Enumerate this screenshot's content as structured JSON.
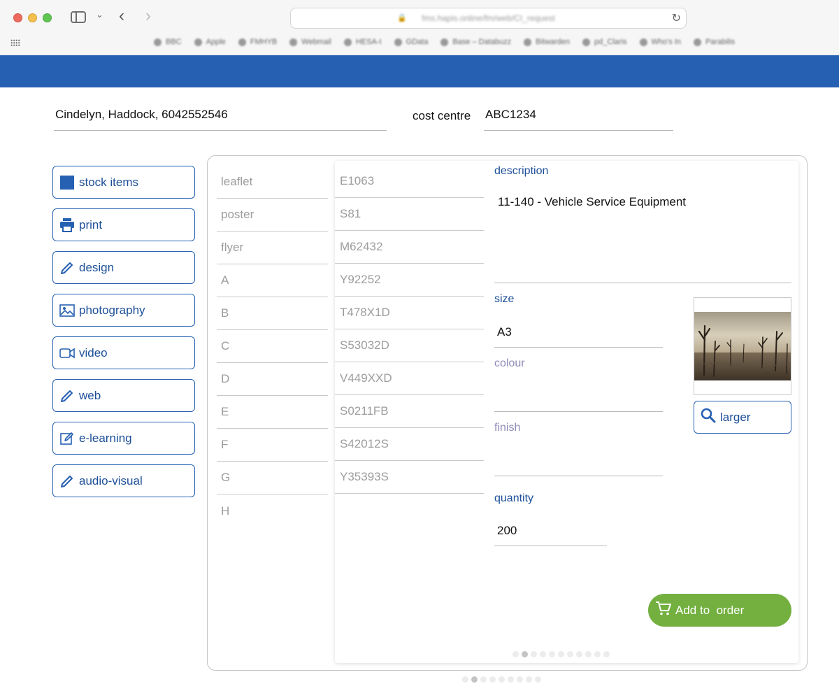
{
  "browser": {
    "url": "fms.hapis.online/fm/web/CI_request",
    "bookmarks": [
      "BBC",
      "Apple",
      "FMHYB",
      "Webmail",
      "HESA-I",
      "GData",
      "Base – Databuzz",
      "Bitwarden",
      "pd_Claris",
      "Who's In",
      "Parabilis"
    ]
  },
  "form": {
    "customer": "Cindelyn, Haddock, 6042552546",
    "cost_centre_label": "cost centre",
    "cost_centre_value": "ABC1234"
  },
  "menu": [
    {
      "label": "stock items",
      "icon": "square-icon"
    },
    {
      "label": "print",
      "icon": "printer-icon"
    },
    {
      "label": "design",
      "icon": "pencil-icon"
    },
    {
      "label": "photography",
      "icon": "image-icon"
    },
    {
      "label": "video",
      "icon": "video-camera-icon"
    },
    {
      "label": "web",
      "icon": "pencil-icon"
    },
    {
      "label": "e-learning",
      "icon": "edit-box-icon"
    },
    {
      "label": "audio-visual",
      "icon": "pencil-icon"
    }
  ],
  "categories": [
    "leaflet",
    "poster",
    "flyer",
    "A",
    "B",
    "C",
    "D",
    "E",
    "F",
    "G",
    "H"
  ],
  "codes": [
    "E1063",
    "S81",
    "M62432",
    "Y92252",
    "T478X1D",
    "S53032D",
    "V449XXD",
    "S0211FB",
    "S42012S",
    "Y35393S"
  ],
  "detail": {
    "description_label": "description",
    "description_value": "11-140 - Vehicle Service Equipment",
    "size_label": "size",
    "size_value": "A3",
    "colour_label": "colour",
    "colour_value": "",
    "finish_label": "finish",
    "finish_value": "",
    "quantity_label": "quantity",
    "quantity_value": "200",
    "larger_label": "larger",
    "add_label": "Add to  order"
  },
  "pagination": {
    "card_dots": 11,
    "card_active": 1,
    "panel_dots": 9,
    "panel_active": 1
  },
  "colors": {
    "brand_blue": "#2660b2",
    "label_blue": "#1d4f99",
    "add_green": "#73b03f"
  }
}
